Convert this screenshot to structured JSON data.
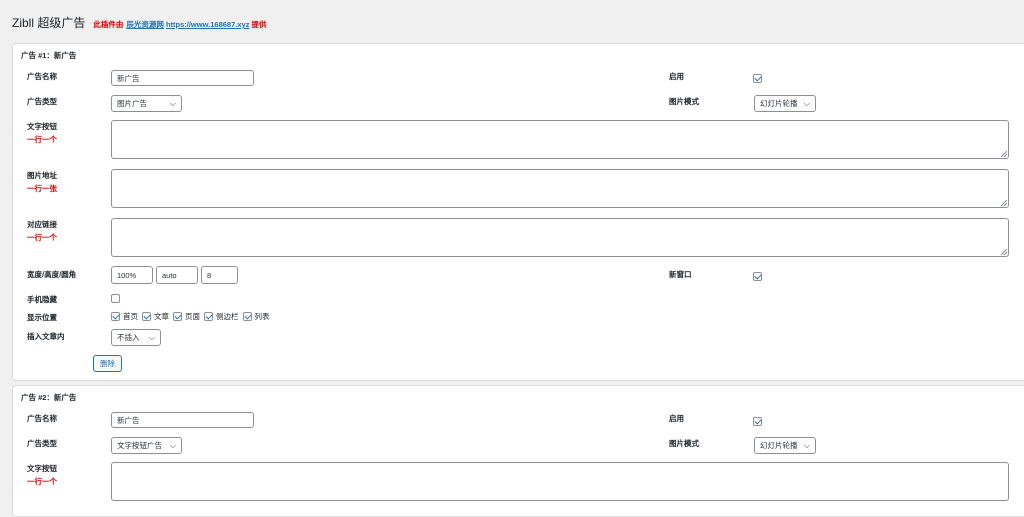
{
  "header": {
    "title": "Zibll 超级广告",
    "credit_prefix": "此插件由",
    "credit_site": "辰光资源网",
    "credit_url": "https://www.168687.xyz",
    "credit_suffix": "提供"
  },
  "labels": {
    "ad_name": "广告名称",
    "enabled": "启用",
    "ad_type": "广告类型",
    "image_mode": "图片模式",
    "text_button": "文字按钮",
    "one_per_line": "一行一个",
    "image_url": "图片地址",
    "one_per_line_image": "一行一张",
    "link": "对应链接",
    "size": "宽度/高度/圆角",
    "new_window": "新窗口",
    "mobile_hide": "手机隐藏",
    "display_position": "显示位置",
    "insert_in_post": "插入文章内",
    "delete": "删除"
  },
  "ads": [
    {
      "title": "广告 #1：新广告",
      "name": "新广告",
      "enabled": true,
      "type": "图片广告",
      "image_mode": "幻灯片轮播",
      "width": "100%",
      "height": "auto",
      "radius": "8",
      "new_window": true,
      "mobile_hide": false,
      "positions": [
        {
          "label": "首页",
          "checked": true
        },
        {
          "label": "文章",
          "checked": true
        },
        {
          "label": "页面",
          "checked": true
        },
        {
          "label": "侧边栏",
          "checked": true
        },
        {
          "label": "列表",
          "checked": true
        }
      ],
      "insert": "不插入"
    },
    {
      "title": "广告 #2：新广告",
      "name": "新广告",
      "enabled": true,
      "type": "文字按钮广告",
      "image_mode": "幻灯片轮播"
    }
  ],
  "icons": {
    "chevron": "chevron-down-icon",
    "check": "check-icon"
  },
  "colors": {
    "accent": "#2271b1",
    "hint_red": "#dd0000",
    "background": "#f0f0f1"
  }
}
